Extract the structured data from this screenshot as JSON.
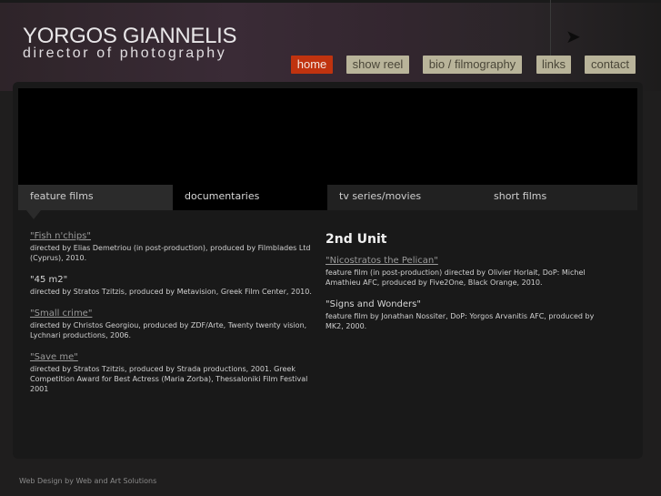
{
  "header": {
    "title": "YORGOS GIANNELIS",
    "subtitle": "director of photography"
  },
  "nav": [
    {
      "label": "home",
      "active": true
    },
    {
      "label": "show reel"
    },
    {
      "label": "bio / filmography"
    },
    {
      "label": "links"
    },
    {
      "label": "contact"
    }
  ],
  "tabs": [
    "feature films",
    "documentaries",
    "tv series/movies",
    "short films"
  ],
  "left": [
    {
      "title": "\"Fish n'chips\"",
      "link": true,
      "desc": "directed by Elias Demetriou (in post-production), produced by Filmblades Ltd (Cyprus), 2010."
    },
    {
      "title": "\"45 m2\"",
      "link": false,
      "desc": "directed by Stratos Tzitzis, produced by Metavision, Greek Film Center, 2010."
    },
    {
      "title": "\"Small crime\"",
      "link": true,
      "desc": "directed by Christos Georgiou, produced by ZDF/Arte, Twenty twenty vision, Lychnari productions, 2006."
    },
    {
      "title": "\"Save me\"",
      "link": true,
      "desc": "directed by Stratos Tzitzis, produced by Strada productions, 2001. Greek Competition Award for Best Actress (Maria Zorba), Thessaloniki Film Festival 2001"
    }
  ],
  "right": {
    "heading": "2nd Unit",
    "items": [
      {
        "title": "\"Nicostratos the Pelican\"",
        "link": true,
        "desc": "feature film (in post-production) directed by Olivier Horlait, DoP: Michel Amathieu AFC, produced by Five2One, Black Orange, 2010."
      },
      {
        "title": "\"Signs and Wonders\"",
        "link": false,
        "desc": "feature film by Jonathan Nossiter, DoP: Yorgos Arvanitis AFC, produced by MK2, 2000."
      }
    ]
  },
  "footer": "Web Design by Web and Art Solutions",
  "colors": {
    "accent": "#c0330f",
    "nav_bg": "#b9b49a"
  }
}
